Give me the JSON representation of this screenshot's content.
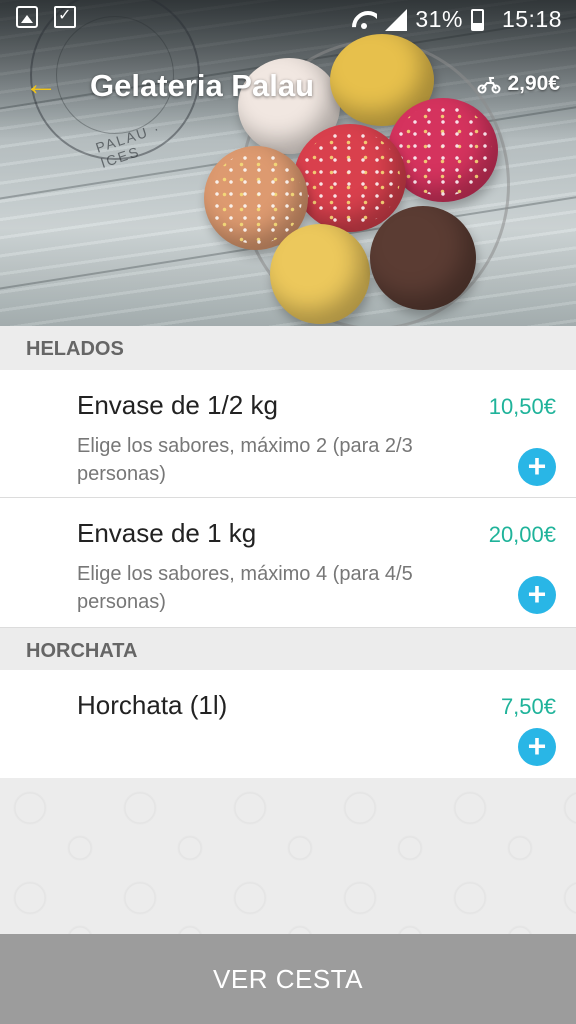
{
  "status_bar": {
    "battery": "31%",
    "time": "15:18"
  },
  "header": {
    "title": "Gelateria Palau",
    "delivery_fee": "2,90€",
    "logo_text": "GELATERIA PALAU BARCELONA · ICES & CREAMS"
  },
  "sections": [
    {
      "title": "HELADOS",
      "items": [
        {
          "name": "Envase de 1/2 kg",
          "price": "10,50€",
          "description": "Elige los sabores, máximo 2 (para 2/3 personas)"
        },
        {
          "name": "Envase de 1 kg",
          "price": "20,00€",
          "description": "Elige los sabores, máximo 4 (para 4/5 personas)"
        }
      ]
    },
    {
      "title": "HORCHATA",
      "items": [
        {
          "name": "Horchata (1l)",
          "price": "7,50€",
          "description": ""
        }
      ]
    }
  ],
  "footer": {
    "cart_label": "VER CESTA"
  },
  "colors": {
    "accent_back": "#f2c417",
    "price": "#1fb39a",
    "add_button": "#29b6e6",
    "cart_button": "#9c9c9c"
  }
}
